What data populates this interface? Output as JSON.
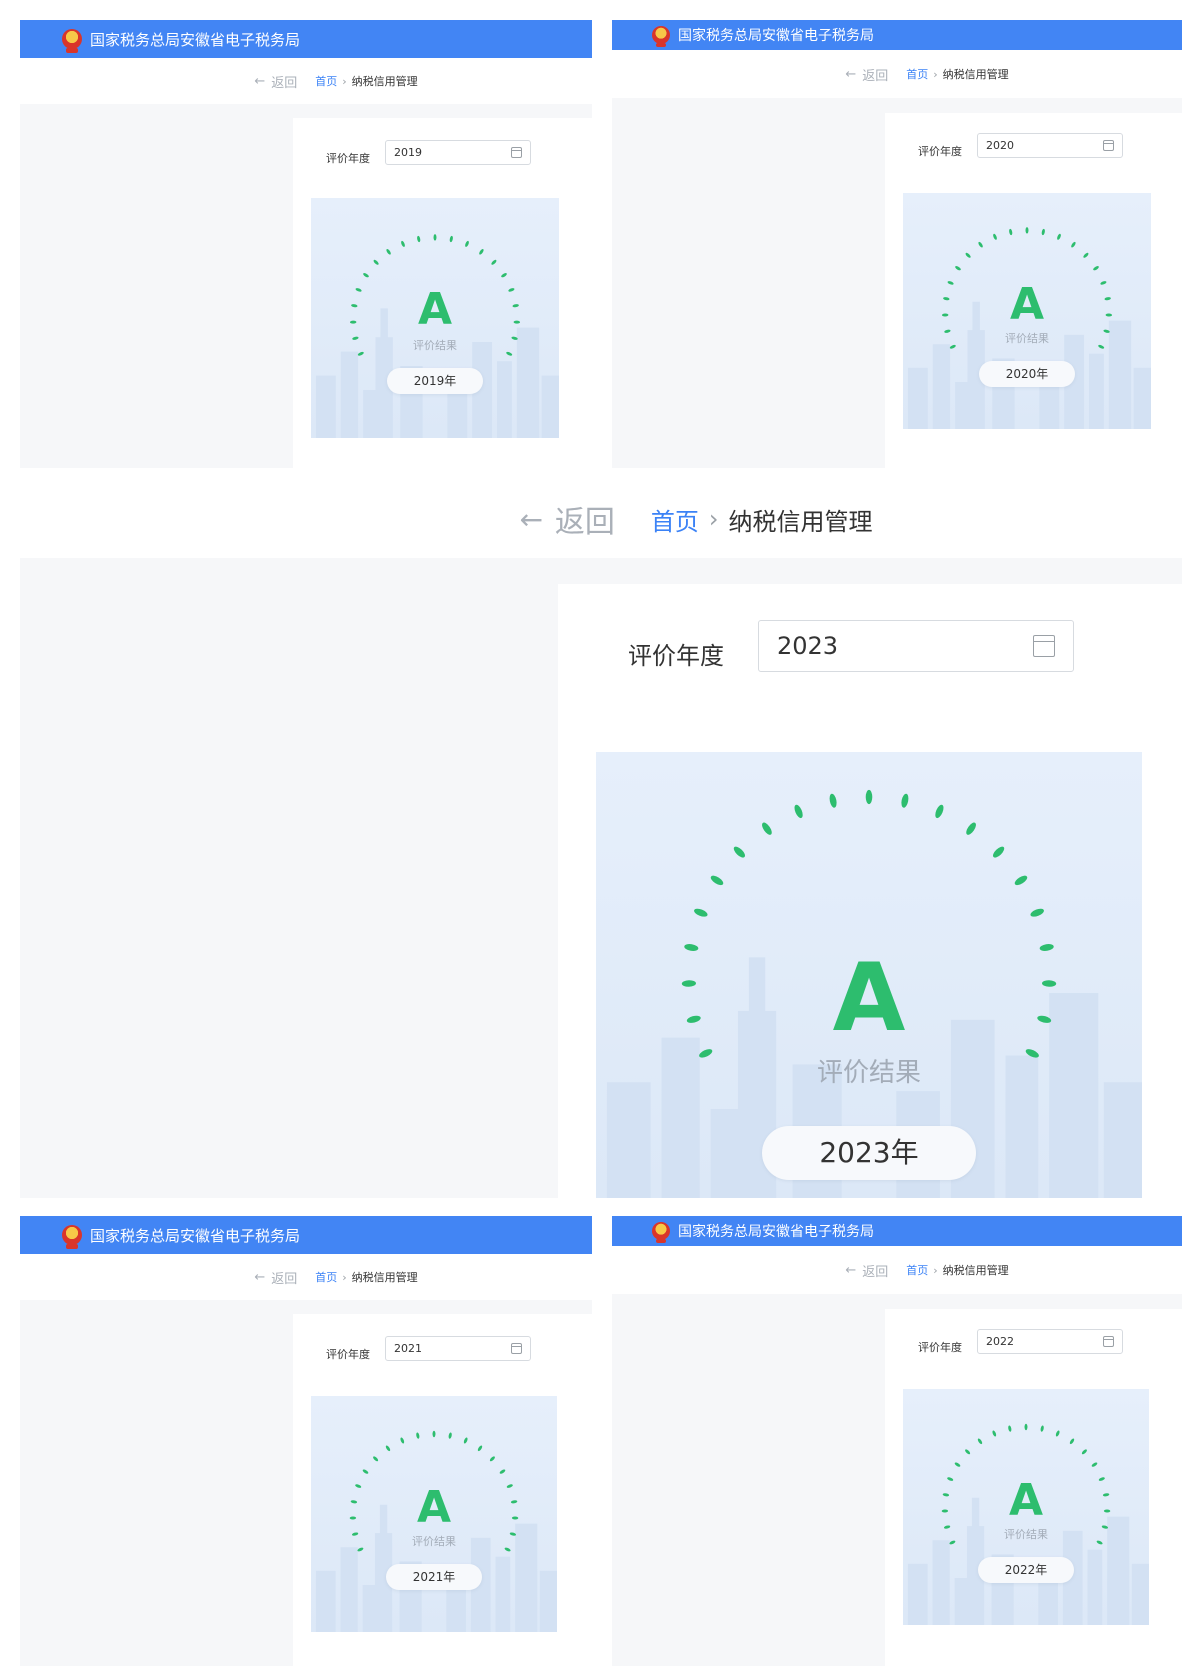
{
  "app": {
    "title": "国家税务总局安徽省电子税务局"
  },
  "nav": {
    "back_label": "返回",
    "home_label": "首页",
    "separator": "›",
    "current_page": "纳税信用管理"
  },
  "form": {
    "year_label": "评价年度"
  },
  "result": {
    "caption": "评价结果"
  },
  "panels": [
    {
      "year": "2019",
      "grade": "A",
      "pill": "2019年"
    },
    {
      "year": "2020",
      "grade": "A",
      "pill": "2020年"
    },
    {
      "year": "2023",
      "grade": "A",
      "pill": "2023年"
    },
    {
      "year": "2021",
      "grade": "A",
      "pill": "2021年"
    },
    {
      "year": "2022",
      "grade": "A",
      "pill": "2022年"
    }
  ],
  "colors": {
    "header_blue": "#4285f4",
    "grade_green": "#2dbd6e",
    "link_blue": "#3b82f6"
  },
  "icons": {
    "back": "arrow-left-icon",
    "date": "calendar-icon",
    "logo": "tax-emblem-icon"
  }
}
